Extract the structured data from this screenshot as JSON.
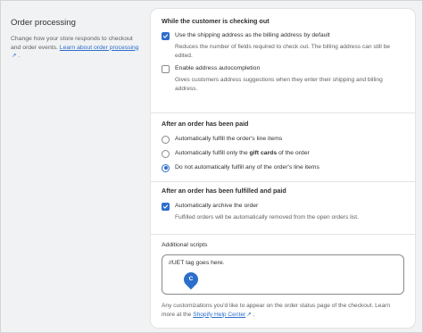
{
  "section": {
    "title": "Order processing",
    "desc_text": "Change how your store responds to checkout and order events.",
    "learn_link": "Learn about order processing",
    "desc_end": "."
  },
  "checkout": {
    "title": "While the customer is checking out",
    "use_shipping": {
      "label": "Use the shipping address as the billing address by default",
      "checked": true,
      "help": "Reduces the number of fields required to check out. The billing address can still be edited."
    },
    "autocomplete": {
      "label": "Enable address autocompletion",
      "checked": false,
      "help": "Gives customers address suggestions when they enter their shipping and billing address."
    }
  },
  "paid": {
    "title": "After an order has been paid",
    "options": [
      {
        "text": "Automatically fulfill the order's line items",
        "checked": false
      },
      {
        "pre": "Automatically fulfill only the ",
        "bold": "gift cards",
        "post": " of the order",
        "checked": false
      },
      {
        "text": "Do not automatically fulfill any of the order's line items",
        "checked": true
      }
    ]
  },
  "fulfilled": {
    "title": "After an order has been fulfilled and paid",
    "archive": {
      "label": "Automatically archive the order",
      "checked": true,
      "help": "Fulfilled orders will be automatically removed from the open orders list."
    }
  },
  "scripts": {
    "label": "Additional scripts",
    "value": "//UET tag goes here.",
    "badge_letter": "C",
    "footer_text": "Any customizations you'd like to appear on the order status page of the checkout. Learn more at the",
    "help_link": "Shopify Help Center",
    "footer_end": "."
  },
  "colors": {
    "accent": "#2c6ecb",
    "page_bg": "#f1f2f4",
    "card_bg": "#ffffff",
    "muted_text": "#616161"
  }
}
